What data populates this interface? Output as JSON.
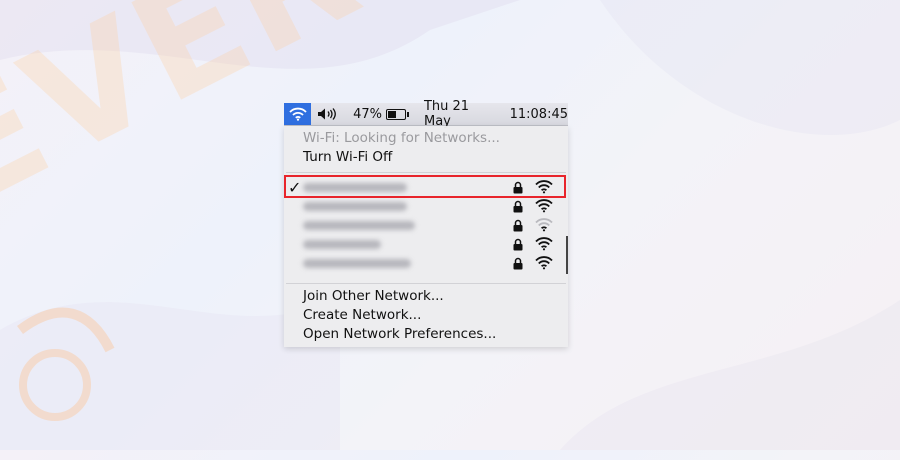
{
  "menubar": {
    "battery_percent": "47%",
    "battery_level": 0.47,
    "date": "Thu 21 May",
    "time": "11:08:45",
    "wifi_icon": "wifi-icon",
    "volume_icon": "speaker-icon",
    "accent_color": "#2f6fe0"
  },
  "menu": {
    "status": "Wi-Fi: Looking for Networks...",
    "toggle_label": "Turn Wi-Fi Off",
    "networks": [
      {
        "selected": true,
        "locked": true,
        "signal": 4
      },
      {
        "selected": false,
        "locked": true,
        "signal": 4
      },
      {
        "selected": false,
        "locked": true,
        "signal": 2
      },
      {
        "selected": false,
        "locked": true,
        "signal": 4
      },
      {
        "selected": false,
        "locked": true,
        "signal": 4
      }
    ],
    "selected_mark": "✓",
    "join_other": "Join Other Network...",
    "create_network": "Create Network...",
    "open_prefs": "Open Network Preferences..."
  },
  "highlight_color": "#e8242b"
}
